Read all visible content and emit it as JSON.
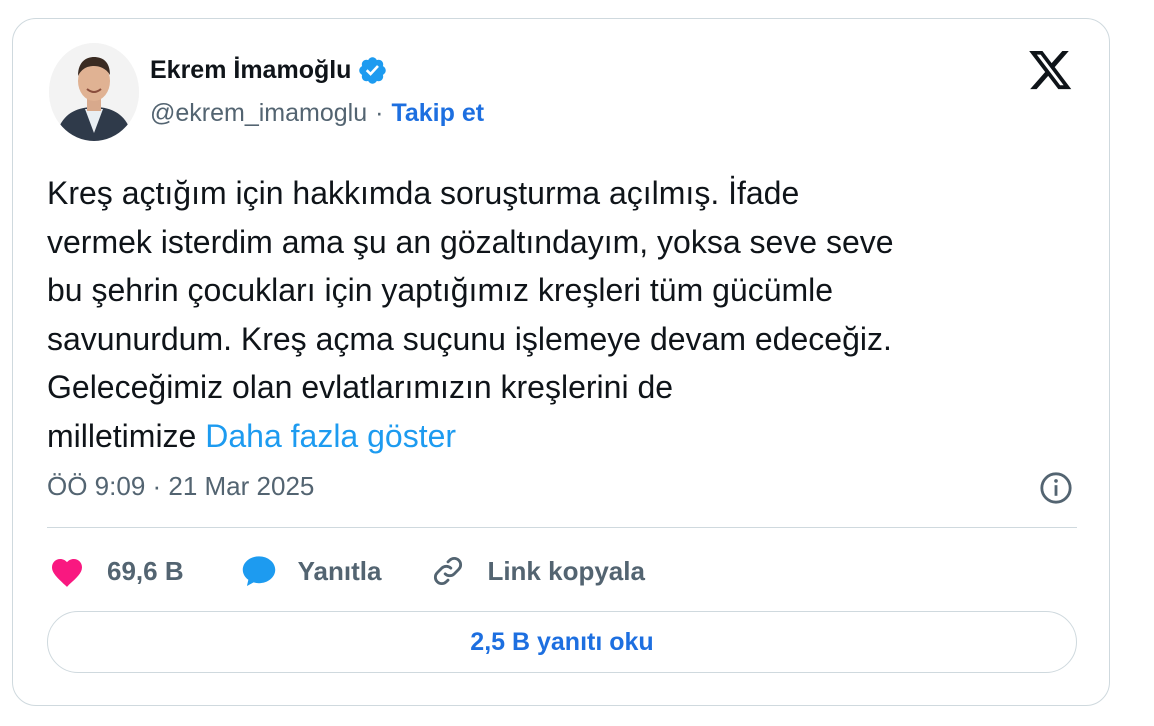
{
  "author": {
    "name": "Ekrem İmamoğlu",
    "handle": "@ekrem_imamoglu",
    "separator": "·",
    "follow_label": "Takip et"
  },
  "icons": {
    "platform": "x-logo-icon",
    "verified": "verified-badge-icon",
    "info": "info-icon",
    "like": "heart-icon",
    "reply": "reply-bubble-icon",
    "link": "link-icon"
  },
  "tweet": {
    "text": "Kreş açtığım için hakkımda soruşturma açılmış. İfade\nvermek isterdim ama şu an gözaltındayım, yoksa seve seve\nbu şehrin çocukları için yaptığımız kreşleri tüm gücümle\nsavunurdum. Kreş açma suçunu işlemeye devam edeceğiz.\nGeleceğimiz olan evlatlarımızın kreşlerini de\nmilletimize ",
    "show_more": "Daha fazla göster",
    "timestamp": "ÖÖ 9:09 · 21 Mar 2025"
  },
  "actions": {
    "likes": "69,6 B",
    "reply_label": "Yanıtla",
    "copy_link_label": "Link kopyala"
  },
  "read_replies_label": "2,5 B yanıtı oku",
  "colors": {
    "accent": "#1d9bf0",
    "follow": "#1d6fe0",
    "like": "#f91880",
    "verified": "#1d9bf0",
    "secondary_text": "#536471",
    "border": "#cfd9de"
  }
}
